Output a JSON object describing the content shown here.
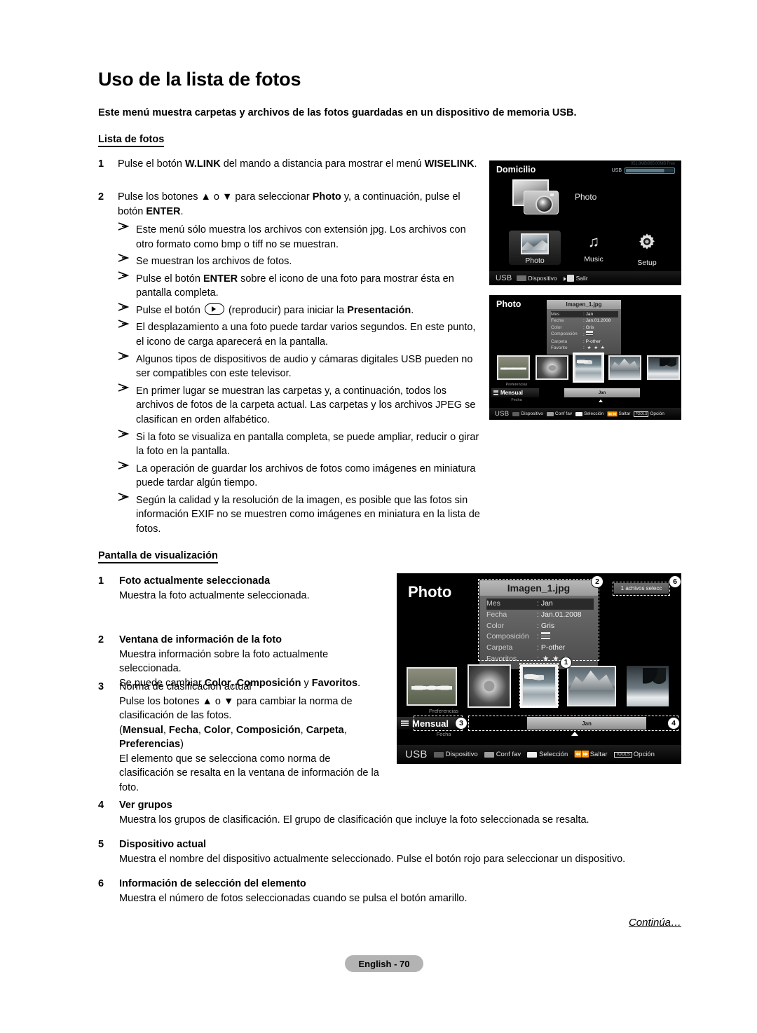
{
  "document": {
    "title": "Uso de la lista de fotos",
    "intro": "Este menú muestra carpetas y archivos de las fotos guardadas en un dispositivo de memoria USB.",
    "subhead_lista": "Lista de fotos",
    "subhead_pantalla": "Pantalla de visualización",
    "continua": "Continúa…",
    "page_label": "English - 70"
  },
  "steps": [
    {
      "num": "1",
      "text_pre": "Pulse el botón ",
      "bold1": "W.LINK",
      "text_mid": " del mando a distancia para mostrar el menú ",
      "bold2": "WISELINK",
      "text_post": "."
    },
    {
      "num": "2",
      "text_pre": "Pulse los botones ▲ o ▼ para seleccionar ",
      "bold1": "Photo",
      "text_mid": " y, a continuación, pulse el botón ",
      "bold2": "ENTER",
      "text_post": "."
    }
  ],
  "bullets": [
    "Este menú sólo muestra los archivos con extensión jpg. Los archivos con otro formato como bmp o tiff no se muestran.",
    "Se muestran los archivos de fotos.",
    "Pulse el botón ENTER sobre el icono de una foto para mostrar ésta en pantalla completa.",
    "Pulse el botón (reproducir) para iniciar la Presentación.",
    "El desplazamiento a una foto puede tardar varios segundos. En este punto, el icono de carga aparecerá en la pantalla.",
    "Algunos tipos de dispositivos de audio y cámaras digitales USB pueden no ser compatibles con este televisor.",
    "En primer lugar se muestran las carpetas y, a continuación, todos los archivos de fotos de la carpeta actual. Las carpetas y los archivos JPEG se clasifican en orden alfabético.",
    "Si la foto se visualiza en pantalla completa, se puede ampliar, reducir o girar la foto en la pantalla.",
    "La operación de guardar los archivos de fotos como imágenes en miniatura puede tardar algún tiempo.",
    "Según la calidad y la resolución de la imagen, es posible que las fotos sin información EXIF no se muestren como imágenes en miniatura en la lista de fotos."
  ],
  "bullet_parts": {
    "b3_pre": "Pulse el botón ",
    "b3_bold": "ENTER",
    "b3_post": " sobre el icono de una foto para mostrar ésta en pantalla completa.",
    "b4_pre": "Pulse el botón ",
    "b4_mid": " (reproducir) para iniciar la ",
    "b4_bold": "Presentación",
    "b4_post": "."
  },
  "display_items": [
    {
      "num": "1",
      "heading": "Foto actualmente seleccionada",
      "body": "Muestra la foto actualmente seleccionada."
    },
    {
      "num": "2",
      "heading": "Ventana de información de la foto",
      "body": "Muestra información sobre la foto actualmente seleccionada.",
      "body2_pre": "Se puede cambiar ",
      "b1": "Color",
      "b1_sep": ", ",
      "b2": "Composición",
      "b2_sep": " y ",
      "b3": "Favoritos",
      "body2_post": "."
    },
    {
      "num": "3",
      "heading": "Norma de clasificación actual",
      "body": "Pulse los botones ▲ o ▼ para cambiar la norma de clasificación de las fotos.",
      "opts_open": "(",
      "opts": [
        "Mensual",
        "Fecha",
        "Color",
        "Composición",
        "Carpeta",
        "Preferencias"
      ],
      "opts_close": ")",
      "body3": "El elemento que se selecciona como norma de clasificación se resalta en la ventana de información de la foto."
    },
    {
      "num": "4",
      "heading": "Ver grupos",
      "body": "Muestra los grupos de clasificación. El grupo de clasificación que incluye la foto seleccionada se resalta."
    },
    {
      "num": "5",
      "heading": "Dispositivo actual",
      "body": "Muestra el nombre del dispositivo actualmente seleccionado. Pulse el botón rojo para seleccionar un dispositivo."
    },
    {
      "num": "6",
      "heading": "Información de selección del elemento",
      "body": "Muestra el número de fotos seleccionadas cuando se pulsa el botón amarillo."
    }
  ],
  "tv_home": {
    "title": "Domicilio",
    "usb_label": "USB",
    "free_text": "951.8MB/995.00MB Free",
    "big_label": "Photo",
    "tiles": [
      {
        "caption": "Photo",
        "icon": "photo-thumb-icon",
        "selected": true
      },
      {
        "caption": "Music",
        "icon": "music-note-icon",
        "selected": false
      },
      {
        "caption": "Setup",
        "icon": "gear-icon",
        "selected": false
      }
    ],
    "footer": {
      "device_label": "USB",
      "items": [
        {
          "label": "Dispositivo",
          "color": "#6e6e6e"
        },
        {
          "label": "Salir",
          "icon": "exit-icon"
        }
      ]
    }
  },
  "tv_photo": {
    "title": "Photo",
    "file_name": "Imagen_1.jpg",
    "info_rows": [
      {
        "key": "Mes",
        "sep": ":",
        "value": "Jan",
        "highlight": true
      },
      {
        "key": "Fecha",
        "sep": ":",
        "value": "Jan.01.2008",
        "highlight": false
      },
      {
        "key": "Color",
        "sep": ":",
        "value": "Gris",
        "highlight": false
      },
      {
        "key": "Composición",
        "sep": ":",
        "value": "",
        "icon": "composition-icon",
        "highlight": false
      },
      {
        "key": "Carpeta",
        "sep": ":",
        "value": "P-other",
        "highlight": false
      },
      {
        "key": "Favoritos",
        "sep": ":",
        "value": "★ ★ ★",
        "highlight": false
      }
    ],
    "info_rows_small_last_key": "Favorito",
    "thumbnails": [
      {
        "name": "sheep-thumbnail",
        "art": "art-sheep",
        "selected": false
      },
      {
        "name": "flower-thumbnail",
        "art": "art-flower",
        "selected": false
      },
      {
        "name": "beach-thumbnail",
        "art": "art-beach",
        "selected": true
      },
      {
        "name": "mountain-thumbnail",
        "art": "art-mtn",
        "selected": false
      },
      {
        "name": "palm-thumbnail",
        "art": "art-palm",
        "selected": false
      }
    ],
    "sort": {
      "above": "Preferencias",
      "current": "Mensual",
      "below": "Fecha"
    },
    "group_bar": {
      "active_label": "Jan"
    },
    "selection_count": "1 achivos selecc",
    "footer": {
      "device_label": "USB",
      "items": [
        {
          "label": "Dispositivo",
          "color": "#5c5c5c"
        },
        {
          "label": "Conf fav",
          "color": "#9d9d9d"
        },
        {
          "label": "Selección",
          "color": "#f0f0f0"
        },
        {
          "label": "Saltar",
          "icon": "skip-icon"
        },
        {
          "label": "Opción",
          "icon": "tools-icon",
          "icon_text": "TOOLS"
        }
      ]
    },
    "callouts": [
      "1",
      "2",
      "3",
      "4",
      "6"
    ]
  },
  "colors": {
    "page_bg": "#ffffff",
    "text": "#000000",
    "tv_bg": "#000000",
    "pill_bg": "#b3b3b3"
  }
}
